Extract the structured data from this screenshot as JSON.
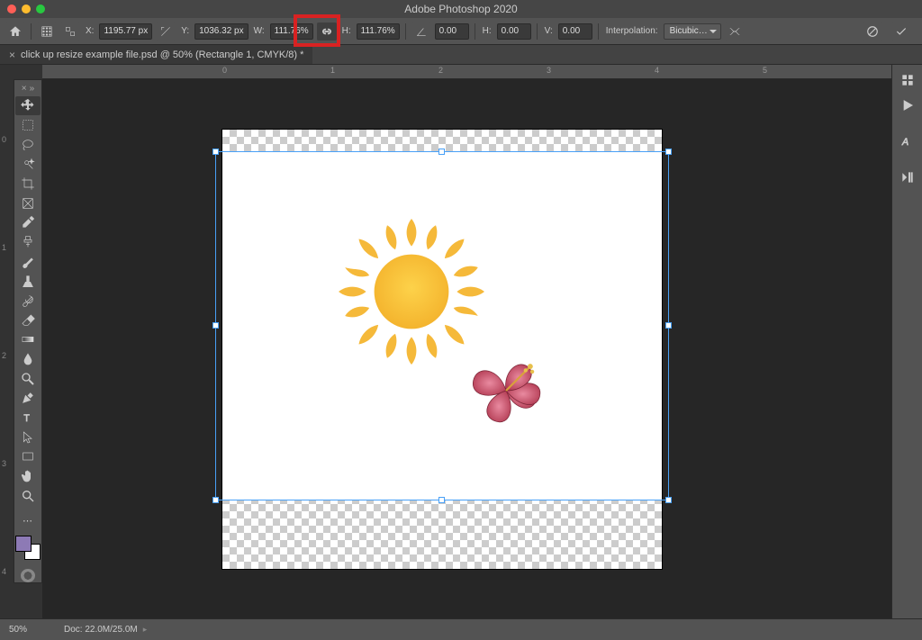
{
  "app_title": "Adobe Photoshop 2020",
  "document_tab": "click up resize example file.psd @ 50% (Rectangle 1, CMYK/8) *",
  "options": {
    "x_label": "X:",
    "x_value": "1195.77 px",
    "y_label": "Y:",
    "y_value": "1036.32 px",
    "w_label": "W:",
    "w_value": "111.76%",
    "h_label": "H:",
    "h_value": "111.76%",
    "angle_value": "0.00",
    "skew_h_label": "H:",
    "skew_h_value": "0.00",
    "skew_v_label": "V:",
    "skew_v_value": "0.00",
    "interp_label": "Interpolation:",
    "interp_value": "Bicubic…"
  },
  "ruler": {
    "h_labels": [
      "0",
      "1",
      "2",
      "3",
      "4",
      "5"
    ],
    "v_labels": [
      "0",
      "1",
      "2",
      "3",
      "4"
    ]
  },
  "status": {
    "zoom": "50%",
    "doc_info": "Doc: 22.0M/25.0M"
  },
  "canvas": {
    "content": "Sun and hibiscus flower illustration on white rectangle over transparent background",
    "selection": "Rectangle 1 free-transform bounding box"
  }
}
